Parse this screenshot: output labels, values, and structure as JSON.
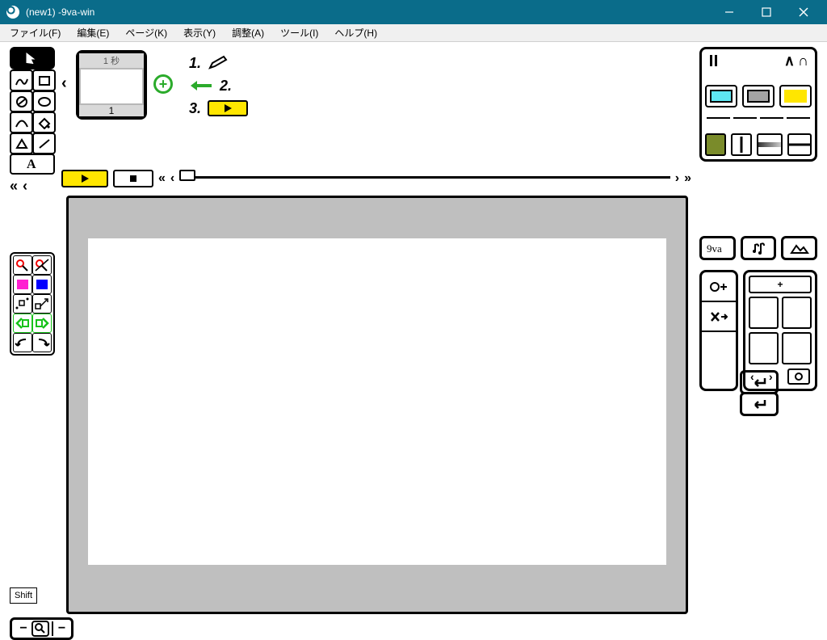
{
  "window": {
    "title": "(new1)   -9va-win"
  },
  "menu": {
    "file": "ファイル(F)",
    "edit": "編集(E)",
    "page": "ページ(K)",
    "view": "表示(Y)",
    "adjust": "調整(A)",
    "tool": "ツール(I)",
    "help": "ヘルプ(H)"
  },
  "timeline": {
    "frame_header": "1 秒",
    "frame_number": "1"
  },
  "hints": {
    "n1": "1.",
    "n2": "2.",
    "n3": "3."
  },
  "shift": {
    "label": "Shift"
  },
  "right_panel": {
    "colors": {
      "cyan": "#5ee7f2",
      "gray": "#a3a3a3",
      "yellow": "#ffe600"
    },
    "olive": "#7a8b2a"
  },
  "color_panel": {
    "magenta": "#ff1fd1",
    "blue": "#0200ff",
    "green": "#17c21a"
  }
}
